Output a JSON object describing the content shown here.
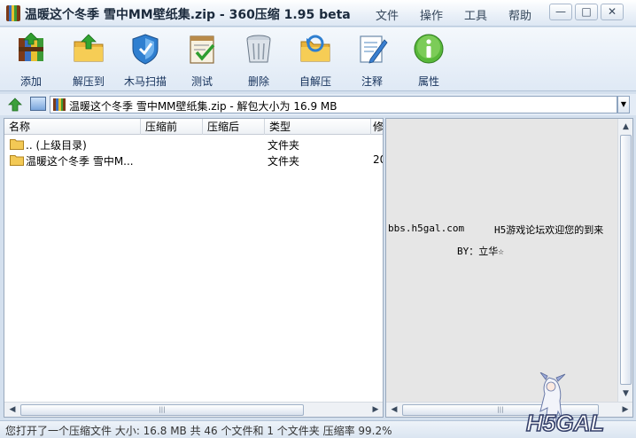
{
  "window": {
    "title": "温暖这个冬季 雪中MM壁纸集.zip - 360压缩 1.95 beta",
    "menu": [
      "文件",
      "操作",
      "工具",
      "帮助"
    ],
    "controls": {
      "minimize": "—",
      "maximize": "□",
      "close": "✕"
    }
  },
  "toolbar": [
    {
      "label": "添加",
      "icon": "archive-add-icon"
    },
    {
      "label": "解压到",
      "icon": "extract-folder-icon"
    },
    {
      "label": "木马扫描",
      "icon": "shield-scan-icon"
    },
    {
      "label": "测试",
      "icon": "test-check-icon"
    },
    {
      "label": "删除",
      "icon": "trash-icon"
    },
    {
      "label": "自解压",
      "icon": "sfx-folder-icon"
    },
    {
      "label": "注释",
      "icon": "comment-pen-icon"
    },
    {
      "label": "属性",
      "icon": "info-icon"
    }
  ],
  "address": {
    "path": "温暖这个冬季 雪中MM壁纸集.zip - 解包大小为 16.9 MB"
  },
  "file_list": {
    "columns": [
      "名称",
      "压缩前",
      "压缩后",
      "类型",
      "修"
    ],
    "rows": [
      {
        "name": ".. (上级目录)",
        "before": "",
        "after": "",
        "type": "文件夹",
        "modified": ""
      },
      {
        "name": "温暖这个冬季 雪中M...",
        "before": "",
        "after": "",
        "type": "文件夹",
        "modified": "20"
      }
    ]
  },
  "preview": {
    "line1_left": "bbs.h5gal.com",
    "line1_right": "H5游戏论坛欢迎您的到来",
    "line2": "BY：立华☆"
  },
  "status": {
    "text": "您打开了一个压缩文件 大小: 16.8 MB 共 46 个文件和 1 个文件夹 压缩率 99.2%"
  },
  "watermark": {
    "logo_text": "H5GAL"
  }
}
